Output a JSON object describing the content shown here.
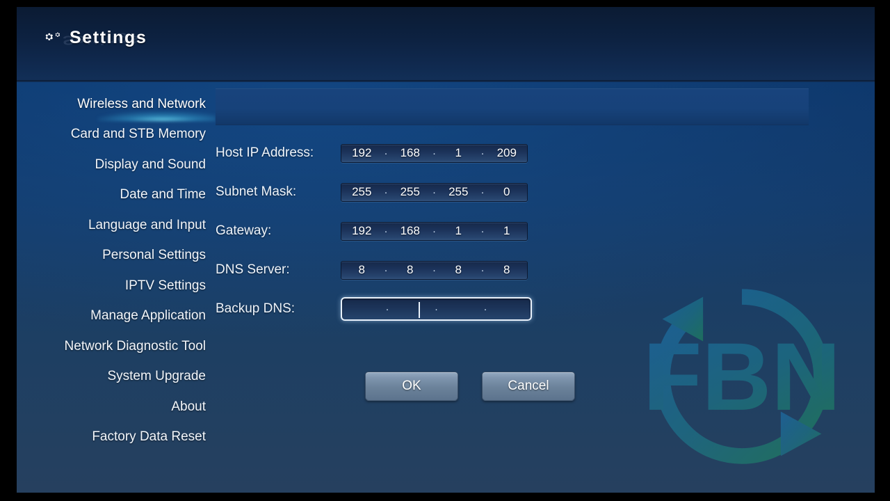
{
  "header": {
    "title": "Settings",
    "gear_icon": "gear-icon"
  },
  "sidebar": {
    "items": [
      {
        "label": "Wireless and Network",
        "selected": true
      },
      {
        "label": "Card and STB Memory",
        "selected": false
      },
      {
        "label": "Display and Sound",
        "selected": false
      },
      {
        "label": "Date and Time",
        "selected": false
      },
      {
        "label": "Language and Input",
        "selected": false
      },
      {
        "label": "Personal Settings",
        "selected": false
      },
      {
        "label": "IPTV Settings",
        "selected": false
      },
      {
        "label": "Manage Application",
        "selected": false
      },
      {
        "label": "Network Diagnostic Tool",
        "selected": false
      },
      {
        "label": "System Upgrade",
        "selected": false
      },
      {
        "label": "About",
        "selected": false
      },
      {
        "label": "Factory Data Reset",
        "selected": false
      }
    ]
  },
  "form": {
    "rows": [
      {
        "label": "Host IP Address:",
        "octets": [
          "192",
          "168",
          "1",
          "209"
        ],
        "focused": false
      },
      {
        "label": "Subnet Mask:",
        "octets": [
          "255",
          "255",
          "255",
          "0"
        ],
        "focused": false
      },
      {
        "label": "Gateway:",
        "octets": [
          "192",
          "168",
          "1",
          "1"
        ],
        "focused": false
      },
      {
        "label": "DNS Server:",
        "octets": [
          "8",
          "8",
          "8",
          "8"
        ],
        "focused": false
      },
      {
        "label": "Backup DNS:",
        "octets": [
          "",
          "",
          "",
          ""
        ],
        "focused": true
      }
    ],
    "separator": "·"
  },
  "buttons": {
    "ok": "OK",
    "cancel": "Cancel"
  },
  "watermark": {
    "text": "FBN",
    "colors": {
      "blue": "#1d6fb8",
      "green": "#1f9960"
    }
  },
  "colors": {
    "accent_glow": "#78ebff",
    "background_top": "#0d3568",
    "background_bottom": "#26405f",
    "banner": "#18437c"
  }
}
